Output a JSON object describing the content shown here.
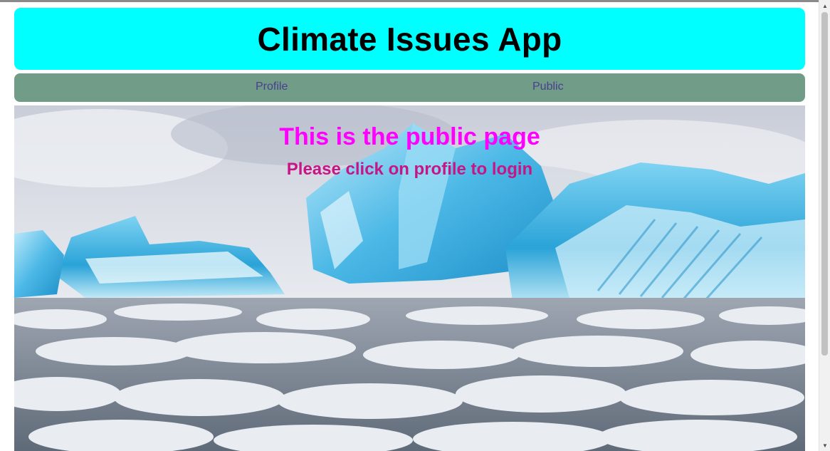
{
  "app": {
    "title": "Climate Issues App"
  },
  "nav": {
    "items": [
      {
        "label": "Profile"
      },
      {
        "label": "Public"
      }
    ]
  },
  "hero": {
    "image": "iceberg-arctic-sea-photo",
    "heading": "This is the public page",
    "subheading": "Please click on profile to login"
  },
  "colors": {
    "header_bg": "#00ffff",
    "nav_bg": "#709c88",
    "nav_link": "#4a3f8c",
    "heading": "#ff00ff",
    "subheading": "#c71585"
  }
}
